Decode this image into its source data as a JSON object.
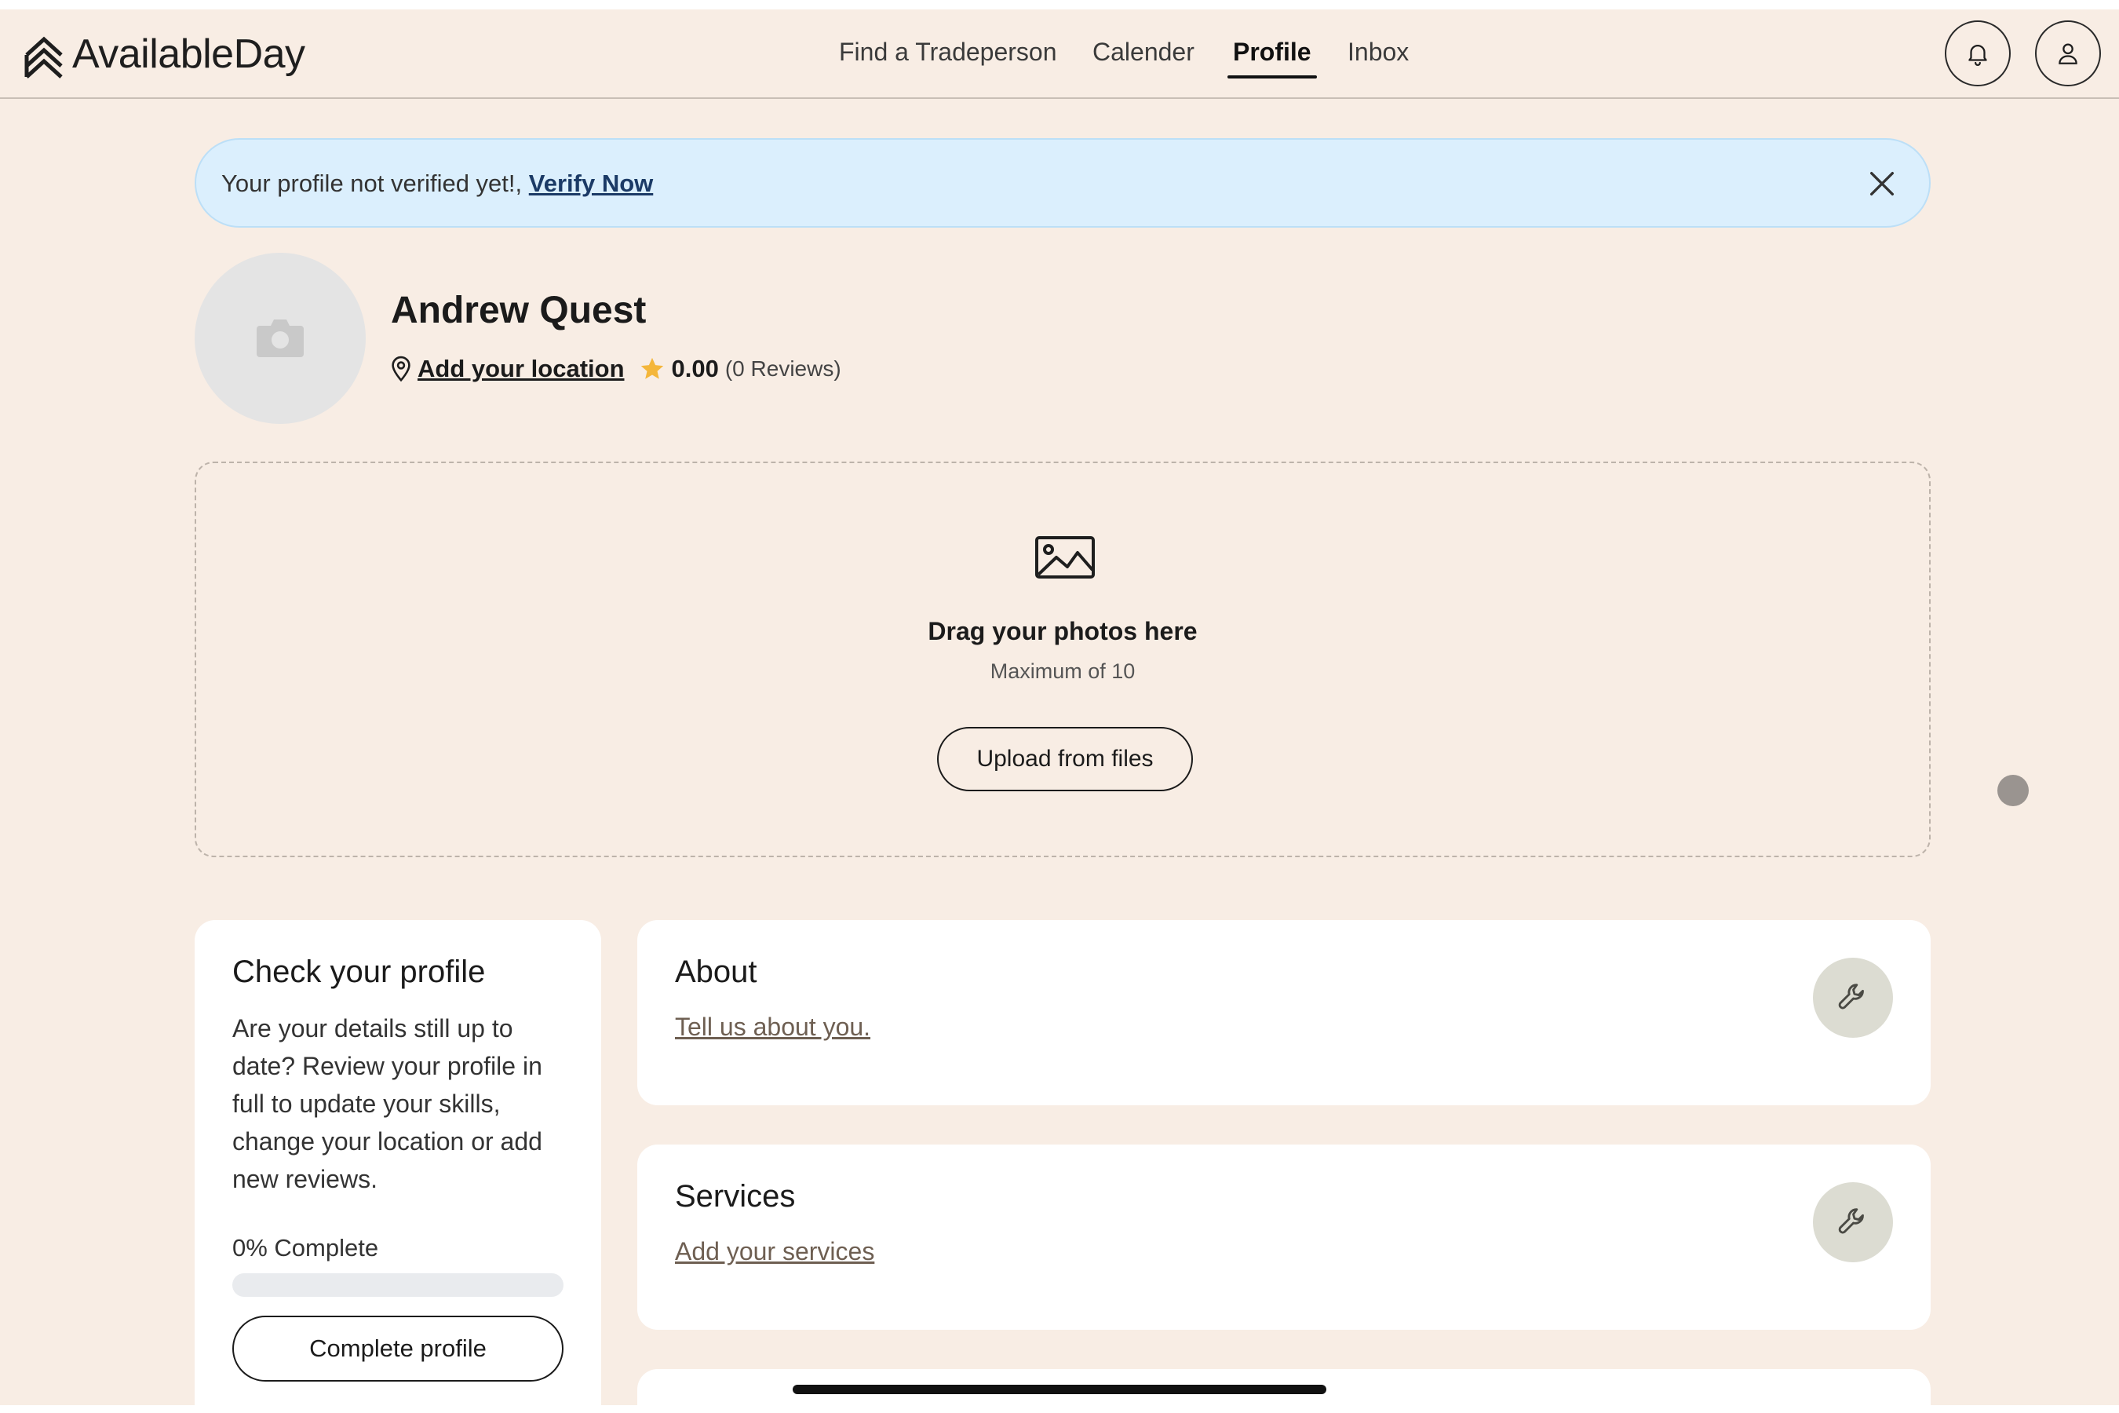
{
  "app": {
    "name": "AvailableDay"
  },
  "nav": {
    "items": [
      {
        "label": "Find a Tradeperson",
        "active": false
      },
      {
        "label": "Calender",
        "active": false
      },
      {
        "label": "Profile",
        "active": true
      },
      {
        "label": "Inbox",
        "active": false
      }
    ],
    "icons": [
      "bell-icon",
      "user-icon"
    ]
  },
  "banner": {
    "text": "Your profile not verified yet!,",
    "link": "Verify Now",
    "color": "#dbeffd"
  },
  "profile": {
    "name": "Andrew Quest",
    "location_link": "Add your location",
    "rating": "0.00",
    "reviews": "(0 Reviews)"
  },
  "dropzone": {
    "title": "Drag your photos here",
    "subtitle": "Maximum of 10",
    "button": "Upload from files"
  },
  "check_profile": {
    "title": "Check your profile",
    "description": "Are your details still up to date? Review your profile in full to update your skills, change your location or add new reviews.",
    "progress_label": "0% Complete",
    "progress_fraction": 0,
    "button": "Complete profile"
  },
  "sections": [
    {
      "title": "About",
      "link": "Tell us about you."
    },
    {
      "title": "Services",
      "link": "Add your services"
    }
  ],
  "colors": {
    "background": "#f8ede4",
    "accent": "#f4b63a",
    "star": "#f4b63a"
  }
}
